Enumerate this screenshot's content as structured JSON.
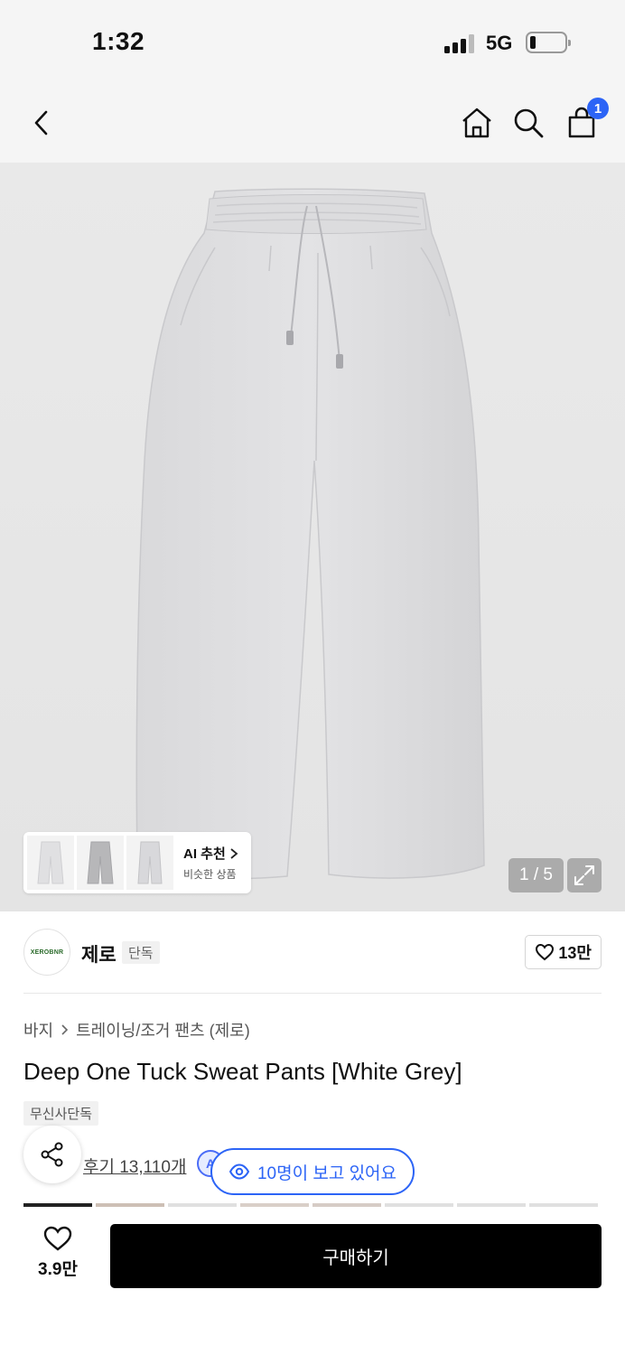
{
  "status_bar": {
    "time": "1:32",
    "network": "5G"
  },
  "nav": {
    "cart_count": "1"
  },
  "gallery": {
    "counter": "1 / 5",
    "ai_recommend": {
      "title": "AI 추천",
      "subtitle": "비슷한 상품"
    }
  },
  "brand": {
    "logo_text": "XEROBNR",
    "name": "제로",
    "tag": "단독",
    "likes": "13만"
  },
  "product": {
    "breadcrumb": [
      "바지",
      "트레이닝/조거 팬츠 (제로)"
    ],
    "title": "Deep One Tuck Sweat Pants [White Grey]",
    "exclusive_tag": "무신사단독",
    "reviews": "후기 13,110개",
    "ai_chip": "A",
    "viewers": "10명이 보고 있어요"
  },
  "bottom_bar": {
    "like_count": "3.9만",
    "buy_label": "구매하기"
  },
  "colors": {
    "accent": "#2c64f6",
    "buy": "#000000"
  },
  "icons": [
    "back-icon",
    "home-icon",
    "search-icon",
    "bag-icon",
    "expand-icon",
    "heart-icon",
    "share-icon",
    "eye-icon",
    "chevron-right-icon"
  ]
}
